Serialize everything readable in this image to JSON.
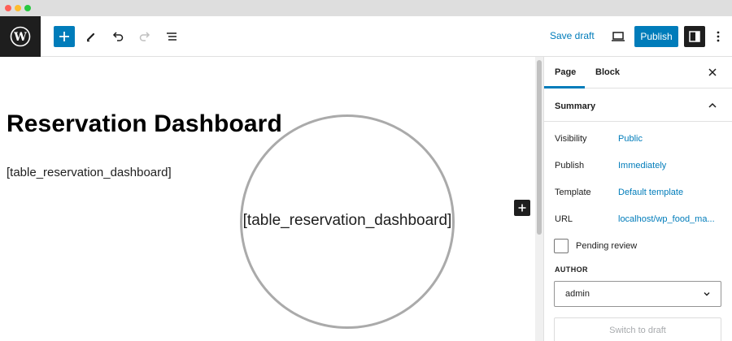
{
  "window": {
    "controls": [
      "close",
      "minimize",
      "maximize"
    ]
  },
  "toolbar": {
    "logo_icon": "wordpress-logo",
    "inserter_icon": "plus-icon",
    "tools_icon": "pencil-icon",
    "undo_icon": "undo-icon",
    "redo_icon": "redo-icon",
    "outline_icon": "list-view-icon",
    "save_draft_label": "Save draft",
    "preview_icon": "desktop-preview-icon",
    "publish_label": "Publish",
    "settings_icon": "sidebar-settings-icon",
    "options_icon": "more-vertical-icon"
  },
  "editor": {
    "title": "Reservation Dashboard",
    "shortcode": "[table_reservation_dashboard]",
    "magnified_text": "[table_reservation_dashboard]",
    "add_block_icon": "plus-icon"
  },
  "sidebar": {
    "tabs": [
      {
        "label": "Page",
        "active": true
      },
      {
        "label": "Block",
        "active": false
      }
    ],
    "close_icon": "close-icon",
    "summary": {
      "title": "Summary",
      "expanded": true,
      "rows": [
        {
          "label": "Visibility",
          "value": "Public"
        },
        {
          "label": "Publish",
          "value": "Immediately"
        },
        {
          "label": "Template",
          "value": "Default template"
        },
        {
          "label": "URL",
          "value": "localhost/wp_food_ma..."
        }
      ],
      "pending_review_label": "Pending review",
      "pending_review_checked": false,
      "author_label": "AUTHOR",
      "author_value": "admin",
      "switch_to_draft_label": "Switch to draft"
    }
  },
  "colors": {
    "accent": "#007cba",
    "dark": "#1e1e1e",
    "border": "#e0e0e0"
  }
}
